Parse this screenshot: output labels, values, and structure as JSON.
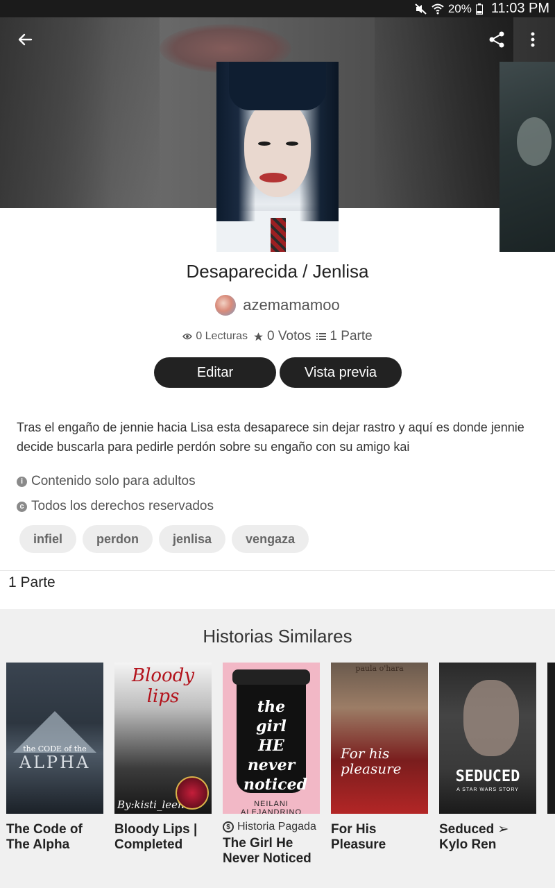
{
  "status_bar": {
    "battery": "20%",
    "time": "11:03 PM"
  },
  "story": {
    "title": "Desaparecida / Jenlisa",
    "author": "azemamamoo",
    "reads": "0 Lecturas",
    "votes": "0 Votos",
    "parts": "1 Parte",
    "description": "Tras el engaño de jennie hacia Lisa esta desaparece sin dejar rastro y aquí es donde jennie decide buscarla para pedirle perdón sobre su engaño con su amigo kai",
    "mature_label": "Contenido solo para adultos",
    "rights_label": "Todos los derechos reservados",
    "tags": [
      "infiel",
      "perdon",
      "jenlisa",
      "vengaza"
    ],
    "parts_section_label": "1 Parte"
  },
  "buttons": {
    "edit": "Editar",
    "preview": "Vista previa"
  },
  "similar": {
    "title": "Historias Similares",
    "books": [
      {
        "title": "The Code of The Alpha",
        "cover_line1": "the CODE of the",
        "cover_line2": "ALPHA"
      },
      {
        "title": "Bloody Lips | Completed",
        "cover_line1": "Bloody lips",
        "cover_line2": "By:kisti_leena"
      },
      {
        "paid_label": "Historia Pagada",
        "title": "The Girl He Never Noticed",
        "cover_line1": "the girl HE never noticed",
        "cover_line2": "NEILANI ALEJANDRINO"
      },
      {
        "title": "For His Pleasure",
        "cover_line1": "paula o'hara",
        "cover_line2": "For his pleasure"
      },
      {
        "title": "Seduced ➢ Kylo Ren",
        "cover_line1": "SEDUCED",
        "cover_line2": "A STAR WARS STORY"
      }
    ]
  },
  "colors": {
    "accent_dark": "#222222",
    "tag_bg": "#ededed",
    "similar_bg": "#f0f0f0"
  },
  "icons": [
    "mute-icon",
    "wifi-icon",
    "battery-icon",
    "back-arrow-icon",
    "share-icon",
    "more-vert-icon",
    "eye-icon",
    "star-icon",
    "list-icon",
    "info-icon",
    "copyright-icon",
    "paid-coin-icon"
  ]
}
